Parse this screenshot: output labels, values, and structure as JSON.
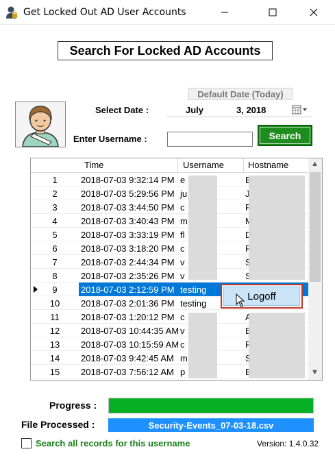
{
  "window": {
    "title": "Get Locked Out AD User Accounts"
  },
  "header": {
    "title": "Search For Locked AD Accounts"
  },
  "date": {
    "default_label": "Default Date (Today)",
    "label": "Select Date :",
    "month": "July",
    "day_year": "3, 2018"
  },
  "username": {
    "label": "Enter Username :",
    "value": ""
  },
  "search": {
    "button_label": "Search"
  },
  "grid": {
    "columns": [
      "Time",
      "Username",
      "Hostname"
    ],
    "rows": [
      {
        "idx": "1",
        "time": "2018-07-03 9:32:14 PM",
        "user": "e",
        "host": "B"
      },
      {
        "idx": "2",
        "time": "2018-07-03 5:29:56 PM",
        "user": "ju",
        "host": "J"
      },
      {
        "idx": "3",
        "time": "2018-07-03 3:44:50 PM",
        "user": "c",
        "host": "F"
      },
      {
        "idx": "4",
        "time": "2018-07-03 3:40:43 PM",
        "user": "m",
        "host": "M"
      },
      {
        "idx": "5",
        "time": "2018-07-03 3:33:19 PM",
        "user": "fl",
        "host": "D"
      },
      {
        "idx": "6",
        "time": "2018-07-03 3:18:20 PM",
        "user": "c",
        "host": "F"
      },
      {
        "idx": "7",
        "time": "2018-07-03 2:44:34 PM",
        "user": "v",
        "host": "S"
      },
      {
        "idx": "8",
        "time": "2018-07-03 2:35:26 PM",
        "user": "v",
        "host": "S"
      },
      {
        "idx": "9",
        "time": "2018-07-03 2:12:59 PM",
        "user": "testing",
        "host": ""
      },
      {
        "idx": "10",
        "time": "2018-07-03 2:01:36 PM",
        "user": "testing",
        "host": ""
      },
      {
        "idx": "11",
        "time": "2018-07-03 1:20:12 PM",
        "user": "c",
        "host": "A"
      },
      {
        "idx": "12",
        "time": "2018-07-03 10:44:35 AM",
        "user": "v",
        "host": "B"
      },
      {
        "idx": "13",
        "time": "2018-07-03 10:15:59 AM",
        "user": "c",
        "host": "F"
      },
      {
        "idx": "14",
        "time": "2018-07-03 9:42:45 AM",
        "user": "m",
        "host": "S"
      },
      {
        "idx": "15",
        "time": "2018-07-03 7:56:12 AM",
        "user": "p",
        "host": "B"
      }
    ]
  },
  "context_menu": {
    "item": "Logoff"
  },
  "progress": {
    "label": "Progress :",
    "value": 1.0
  },
  "file": {
    "label": "File Processed :",
    "value": "Security-Events_07-03-18.csv"
  },
  "search_all": {
    "label": "Search all records for this username"
  },
  "version": "Version: 1.4.0.32",
  "colors": {
    "accent": "#0078d7",
    "search_button": "#1e8c1e",
    "progress": "#06b025",
    "file_box": "#1e90ff"
  }
}
